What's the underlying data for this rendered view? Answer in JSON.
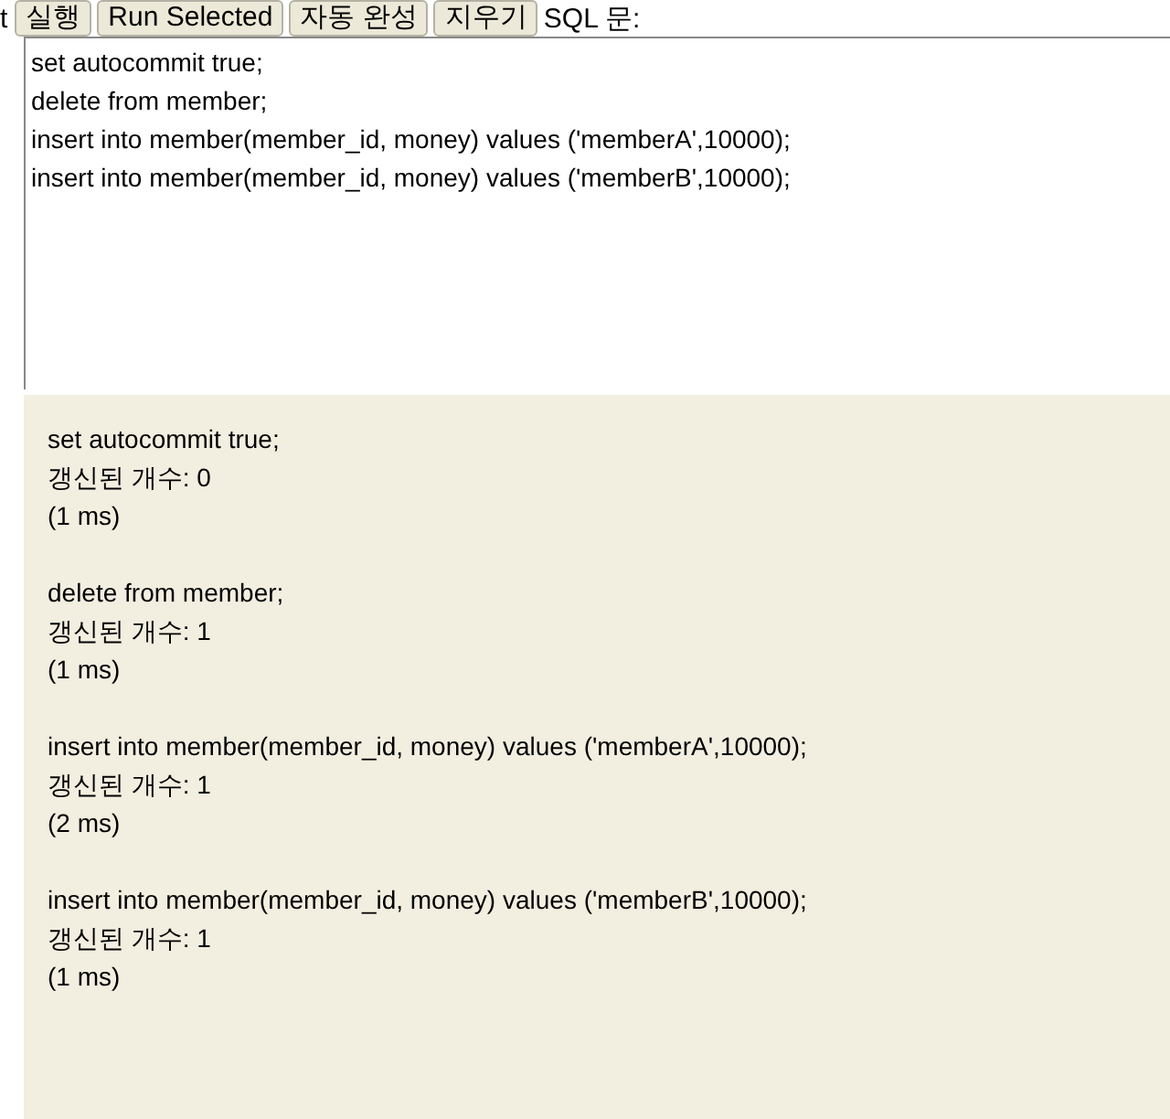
{
  "toolbar": {
    "cut_label": "t",
    "buttons": [
      "실행",
      "Run Selected",
      "자동 완성",
      "지우기"
    ],
    "sql_label": "SQL 문:"
  },
  "editor": {
    "value": "set autocommit true;\ndelete from member;\ninsert into member(member_id, money) values ('memberA',10000);\ninsert into member(member_id, money) values ('memberB',10000);"
  },
  "results": [
    {
      "statement": "set autocommit true;",
      "updated": "갱신된 개수: 0",
      "time": "(1 ms)"
    },
    {
      "statement": "delete from member;",
      "updated": "갱신된 개수: 1",
      "time": "(1 ms)"
    },
    {
      "statement": "insert into member(member_id, money) values ('memberA',10000);",
      "updated": "갱신된 개수: 1",
      "time": "(2 ms)"
    },
    {
      "statement": "insert into member(member_id, money) values ('memberB',10000);",
      "updated": "갱신된 개수: 1",
      "time": "(1 ms)"
    }
  ]
}
